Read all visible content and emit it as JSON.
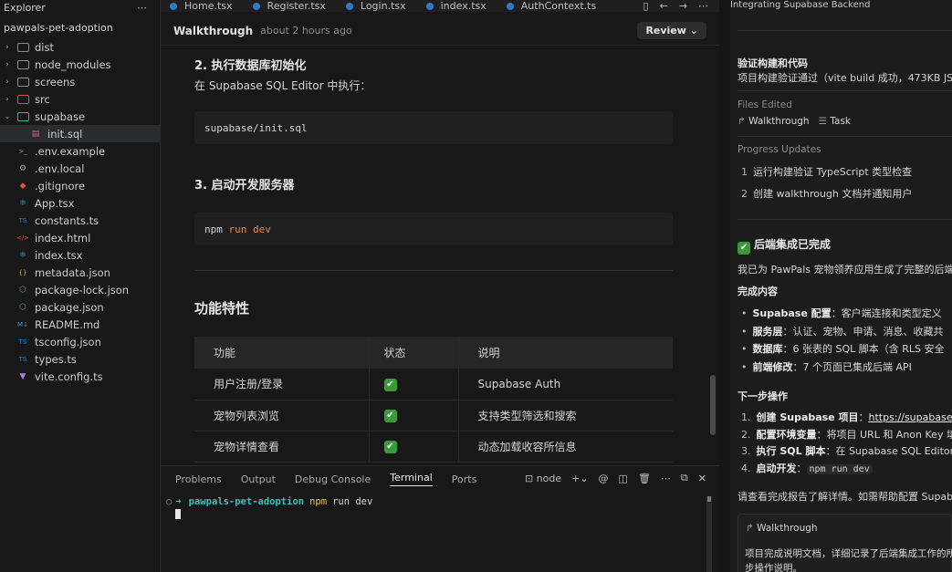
{
  "explorer": {
    "title": "Explorer",
    "menu_icon": "ellipsis-icon",
    "project": "pawpals-pet-adoption",
    "items": [
      {
        "label": "dist",
        "kind": "folder",
        "expanded": false,
        "color": "#8c8c8c"
      },
      {
        "label": "node_modules",
        "kind": "folder",
        "expanded": false,
        "color": "#8c8c8c"
      },
      {
        "label": "screens",
        "kind": "folder",
        "expanded": false,
        "color": "#8c8c8c"
      },
      {
        "label": "src",
        "kind": "folder",
        "expanded": false,
        "color": "#c5563e"
      },
      {
        "label": "supabase",
        "kind": "folder",
        "expanded": true,
        "color": "#47a89a"
      },
      {
        "label": "init.sql",
        "kind": "file",
        "icon": "database-icon",
        "glyph": "▤",
        "color": "#d45f8a",
        "indent": true,
        "selected": true
      },
      {
        "label": ".env.example",
        "kind": "file",
        "icon": "terminal-icon",
        "glyph": ">_",
        "color": "#9a9a9a"
      },
      {
        "label": ".env.local",
        "kind": "file",
        "icon": "gear-icon",
        "glyph": "⚙",
        "color": "#9a9a9a"
      },
      {
        "label": ".gitignore",
        "kind": "file",
        "icon": "git-icon",
        "glyph": "◆",
        "color": "#e0533a"
      },
      {
        "label": "App.tsx",
        "kind": "file",
        "icon": "react-icon",
        "glyph": "⚛",
        "color": "#4fb8d9"
      },
      {
        "label": "constants.ts",
        "kind": "file",
        "icon": "typescript-icon",
        "glyph": "TS",
        "color": "#3178c6"
      },
      {
        "label": "index.html",
        "kind": "file",
        "icon": "html-icon",
        "glyph": "</>",
        "color": "#e0533a"
      },
      {
        "label": "index.tsx",
        "kind": "file",
        "icon": "react-icon",
        "glyph": "⚛",
        "color": "#4fb8d9"
      },
      {
        "label": "metadata.json",
        "kind": "file",
        "icon": "json-icon",
        "glyph": "{}",
        "color": "#d7b44a"
      },
      {
        "label": "package-lock.json",
        "kind": "file",
        "icon": "npm-icon",
        "glyph": "⬡",
        "color": "#47a86a"
      },
      {
        "label": "package.json",
        "kind": "file",
        "icon": "npm-icon",
        "glyph": "⬡",
        "color": "#47a86a"
      },
      {
        "label": "README.md",
        "kind": "file",
        "icon": "markdown-icon",
        "glyph": "M↓",
        "color": "#4f8fd6"
      },
      {
        "label": "tsconfig.json",
        "kind": "file",
        "icon": "typescript-icon",
        "glyph": "TS",
        "color": "#3178c6"
      },
      {
        "label": "types.ts",
        "kind": "file",
        "icon": "typescript-icon",
        "glyph": "TS",
        "color": "#3178c6"
      },
      {
        "label": "vite.config.ts",
        "kind": "file",
        "icon": "vite-icon",
        "glyph": "▼",
        "color": "#a87de0"
      }
    ]
  },
  "tabs": [
    "Home.tsx",
    "Register.tsx",
    "Login.tsx",
    "index.tsx",
    "AuthContext.ts"
  ],
  "walkthrough": {
    "title": "Walkthrough",
    "time": "about 2 hours ago",
    "review_label": "Review",
    "step2_title": "2. 执行数据库初始化",
    "step2_text": "在 Supabase SQL Editor 中执行：",
    "step2_code": "supabase/init.sql",
    "step3_title": "3. 启动开发服务器",
    "step3_code_a": "npm",
    "step3_code_b": "run dev",
    "features_title": "功能特性",
    "table": {
      "headers": [
        "功能",
        "状态",
        "说明"
      ],
      "rows": [
        [
          "用户注册/登录",
          "✔",
          "Supabase Auth"
        ],
        [
          "宠物列表浏览",
          "✔",
          "支持类型筛选和搜索"
        ],
        [
          "宠物详情查看",
          "✔",
          "动态加载收容所信息"
        ]
      ]
    }
  },
  "panel": {
    "tabs": [
      "Problems",
      "Output",
      "Debug Console",
      "Terminal",
      "Ports"
    ],
    "active_tab": "Terminal",
    "shell_label": "node",
    "terminal": {
      "dir": "pawpals-pet-adoption",
      "cmd_a": "npm",
      "cmd_b": "run dev"
    }
  },
  "chat": {
    "title": "Integrating Supabase Backend",
    "verify_title": "验证构建和代码",
    "verify_text": "项目构建验证通过（vite build 成功，473KB JS",
    "files_edited_label": "Files Edited",
    "file_walkthrough": "Walkthrough",
    "file_task": "Task",
    "progress_label": "Progress Updates",
    "progress": [
      {
        "n": "1",
        "text": "运行构建验证 TypeScript 类型检查"
      },
      {
        "n": "2",
        "text": "创建 walkthrough 文档并通知用户"
      }
    ],
    "done_title": "后端集成已完成",
    "done_text": "我已为 PawPals 宠物领养应用生成了完整的后端",
    "complete_title": "完成内容",
    "complete_items": [
      {
        "b": "Supabase 配置",
        "t": "：客户端连接和类型定义"
      },
      {
        "b": "服务层",
        "t": "：认证、宠物、申请、消息、收藏共"
      },
      {
        "b": "数据库",
        "t": "：6 张表的 SQL 脚本（含 RLS 安全"
      },
      {
        "b": "前端修改",
        "t": "：7 个页面已集成后端 API"
      }
    ],
    "next_title": "下一步操作",
    "next_items": [
      {
        "n": "1.",
        "b": "创建 Supabase 项目",
        "t": "：",
        "link": "https://supabase.c"
      },
      {
        "n": "2.",
        "b": "配置环境变量",
        "t": "：将项目 URL 和 Anon Key 填"
      },
      {
        "n": "3.",
        "b": "执行 SQL 脚本",
        "t": "：在 Supabase SQL Editor"
      },
      {
        "n": "4.",
        "b": "启动开发",
        "t": "：",
        "code": "npm run dev"
      }
    ],
    "closing_text": "请查看完成报告了解详情。如需帮助配置 Supab",
    "card_title": "Walkthrough",
    "card_text_1": "项目完成说明文档，详细记录了后端集成工作的所",
    "card_text_2": "步操作说明。"
  },
  "colors": {
    "accent_ts": "#3178c6",
    "terminal_green": "#3fbf7f",
    "terminal_cyan": "#3fbfbf",
    "check_green": "#3a9a3a"
  }
}
